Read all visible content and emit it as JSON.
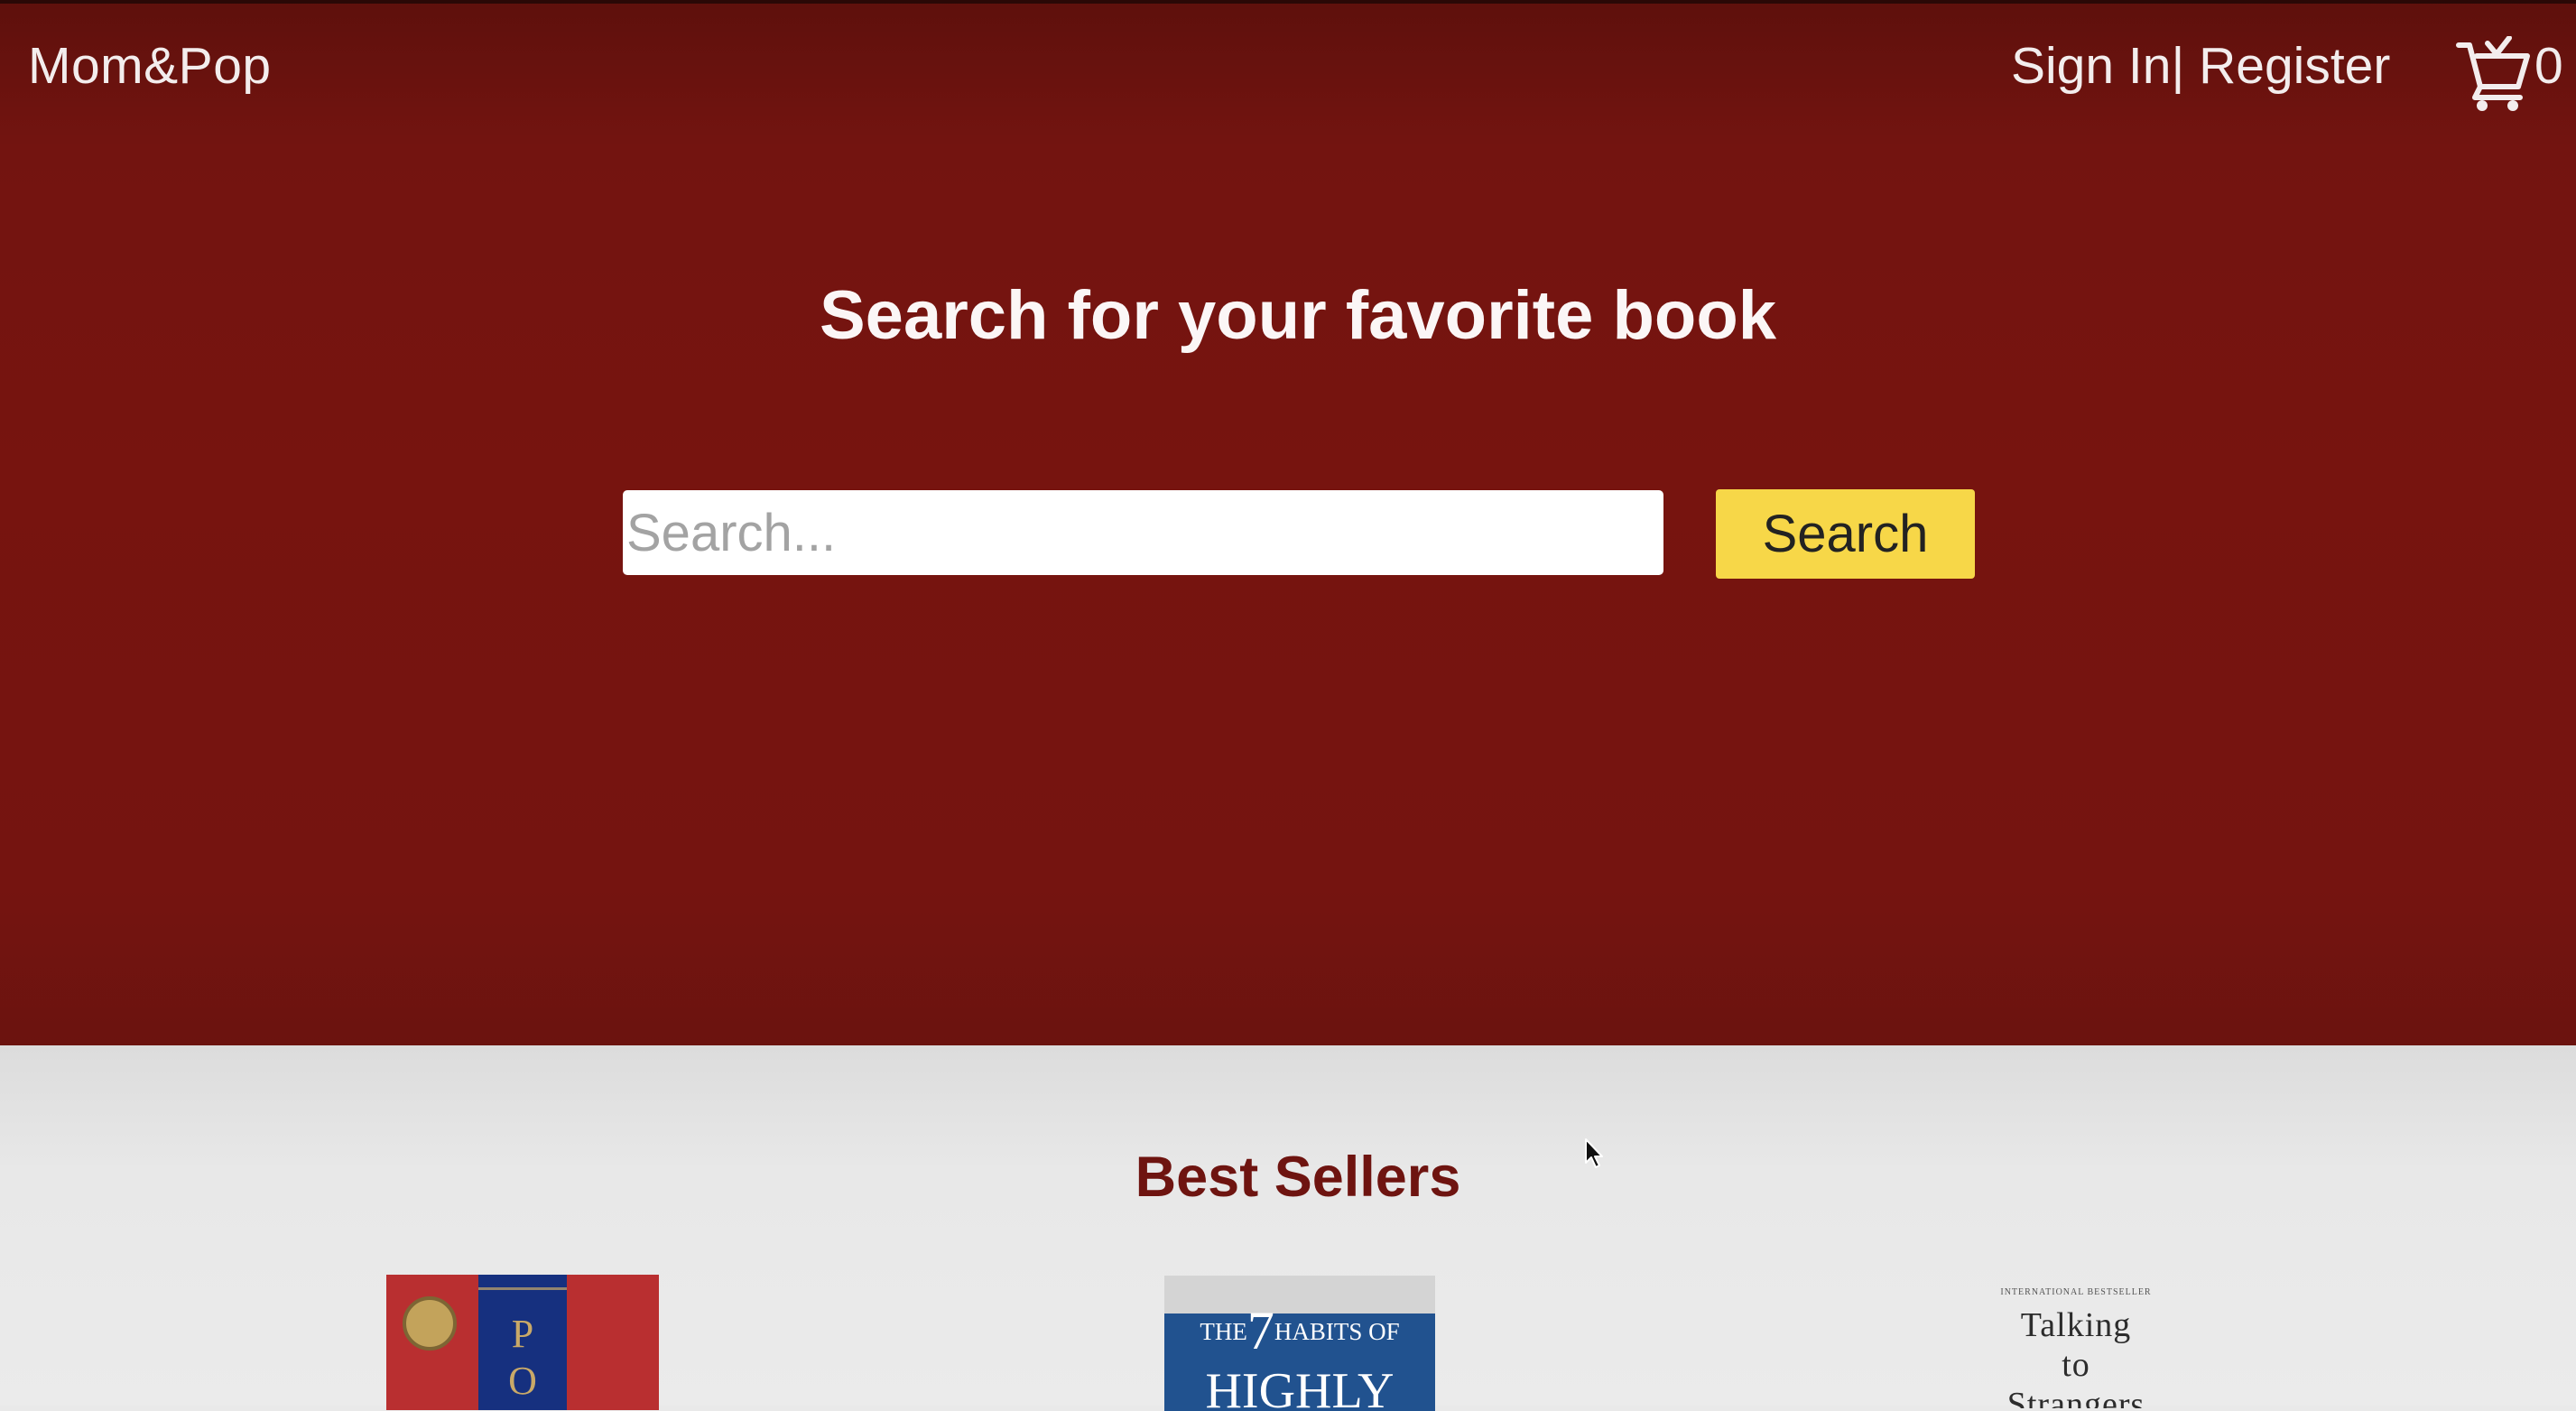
{
  "header": {
    "brand": "Mom&Pop",
    "sign_in": "Sign In",
    "separator": "|",
    "register": " Register",
    "cart_count": "0"
  },
  "hero": {
    "headline": "Search for your favorite book",
    "search_placeholder": "Search...",
    "search_button": "Search"
  },
  "best_sellers": {
    "title": "Best Sellers",
    "books": [
      {
        "cover_letters": [
          "P",
          "O"
        ]
      },
      {
        "cover_prefix": "THE",
        "cover_number": "7",
        "cover_rest": "HABITS OF",
        "cover_line2": "HIGHLY"
      },
      {
        "cover_tag": "INTERNATIONAL BESTSELLER",
        "cover_lines": [
          "Talking",
          "to",
          "Strangers"
        ]
      }
    ]
  },
  "colors": {
    "hero_bg": "#77140f",
    "accent_button": "#f7d748",
    "section_title": "#6e1410"
  }
}
